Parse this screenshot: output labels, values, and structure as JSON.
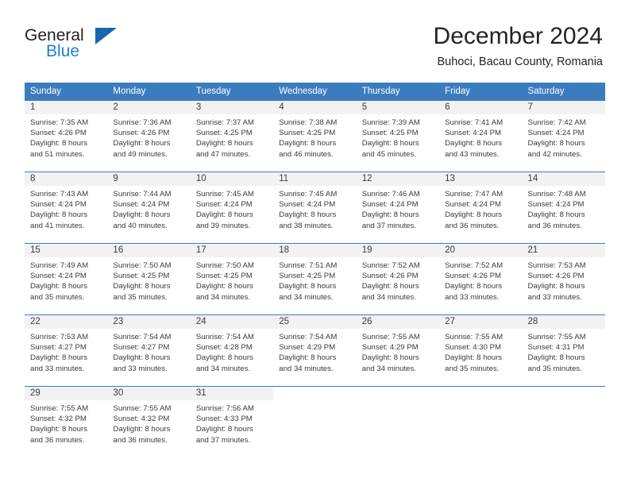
{
  "brand": {
    "name_top": "General",
    "name_bottom": "Blue",
    "accent_color": "#1f7fd0",
    "triangle_color": "#1566ab"
  },
  "header": {
    "title": "December 2024",
    "subtitle": "Buhoci, Bacau County, Romania"
  },
  "calendar": {
    "header_bg": "#3b7cbf",
    "day_bar_bg": "#f2f2f2",
    "weekdays": [
      "Sunday",
      "Monday",
      "Tuesday",
      "Wednesday",
      "Thursday",
      "Friday",
      "Saturday"
    ],
    "weeks": [
      [
        {
          "day": "1",
          "sunrise": "Sunrise: 7:35 AM",
          "sunset": "Sunset: 4:26 PM",
          "daylight_line1": "Daylight: 8 hours",
          "daylight_line2": "and 51 minutes."
        },
        {
          "day": "2",
          "sunrise": "Sunrise: 7:36 AM",
          "sunset": "Sunset: 4:26 PM",
          "daylight_line1": "Daylight: 8 hours",
          "daylight_line2": "and 49 minutes."
        },
        {
          "day": "3",
          "sunrise": "Sunrise: 7:37 AM",
          "sunset": "Sunset: 4:25 PM",
          "daylight_line1": "Daylight: 8 hours",
          "daylight_line2": "and 47 minutes."
        },
        {
          "day": "4",
          "sunrise": "Sunrise: 7:38 AM",
          "sunset": "Sunset: 4:25 PM",
          "daylight_line1": "Daylight: 8 hours",
          "daylight_line2": "and 46 minutes."
        },
        {
          "day": "5",
          "sunrise": "Sunrise: 7:39 AM",
          "sunset": "Sunset: 4:25 PM",
          "daylight_line1": "Daylight: 8 hours",
          "daylight_line2": "and 45 minutes."
        },
        {
          "day": "6",
          "sunrise": "Sunrise: 7:41 AM",
          "sunset": "Sunset: 4:24 PM",
          "daylight_line1": "Daylight: 8 hours",
          "daylight_line2": "and 43 minutes."
        },
        {
          "day": "7",
          "sunrise": "Sunrise: 7:42 AM",
          "sunset": "Sunset: 4:24 PM",
          "daylight_line1": "Daylight: 8 hours",
          "daylight_line2": "and 42 minutes."
        }
      ],
      [
        {
          "day": "8",
          "sunrise": "Sunrise: 7:43 AM",
          "sunset": "Sunset: 4:24 PM",
          "daylight_line1": "Daylight: 8 hours",
          "daylight_line2": "and 41 minutes."
        },
        {
          "day": "9",
          "sunrise": "Sunrise: 7:44 AM",
          "sunset": "Sunset: 4:24 PM",
          "daylight_line1": "Daylight: 8 hours",
          "daylight_line2": "and 40 minutes."
        },
        {
          "day": "10",
          "sunrise": "Sunrise: 7:45 AM",
          "sunset": "Sunset: 4:24 PM",
          "daylight_line1": "Daylight: 8 hours",
          "daylight_line2": "and 39 minutes."
        },
        {
          "day": "11",
          "sunrise": "Sunrise: 7:45 AM",
          "sunset": "Sunset: 4:24 PM",
          "daylight_line1": "Daylight: 8 hours",
          "daylight_line2": "and 38 minutes."
        },
        {
          "day": "12",
          "sunrise": "Sunrise: 7:46 AM",
          "sunset": "Sunset: 4:24 PM",
          "daylight_line1": "Daylight: 8 hours",
          "daylight_line2": "and 37 minutes."
        },
        {
          "day": "13",
          "sunrise": "Sunrise: 7:47 AM",
          "sunset": "Sunset: 4:24 PM",
          "daylight_line1": "Daylight: 8 hours",
          "daylight_line2": "and 36 minutes."
        },
        {
          "day": "14",
          "sunrise": "Sunrise: 7:48 AM",
          "sunset": "Sunset: 4:24 PM",
          "daylight_line1": "Daylight: 8 hours",
          "daylight_line2": "and 36 minutes."
        }
      ],
      [
        {
          "day": "15",
          "sunrise": "Sunrise: 7:49 AM",
          "sunset": "Sunset: 4:24 PM",
          "daylight_line1": "Daylight: 8 hours",
          "daylight_line2": "and 35 minutes."
        },
        {
          "day": "16",
          "sunrise": "Sunrise: 7:50 AM",
          "sunset": "Sunset: 4:25 PM",
          "daylight_line1": "Daylight: 8 hours",
          "daylight_line2": "and 35 minutes."
        },
        {
          "day": "17",
          "sunrise": "Sunrise: 7:50 AM",
          "sunset": "Sunset: 4:25 PM",
          "daylight_line1": "Daylight: 8 hours",
          "daylight_line2": "and 34 minutes."
        },
        {
          "day": "18",
          "sunrise": "Sunrise: 7:51 AM",
          "sunset": "Sunset: 4:25 PM",
          "daylight_line1": "Daylight: 8 hours",
          "daylight_line2": "and 34 minutes."
        },
        {
          "day": "19",
          "sunrise": "Sunrise: 7:52 AM",
          "sunset": "Sunset: 4:26 PM",
          "daylight_line1": "Daylight: 8 hours",
          "daylight_line2": "and 34 minutes."
        },
        {
          "day": "20",
          "sunrise": "Sunrise: 7:52 AM",
          "sunset": "Sunset: 4:26 PM",
          "daylight_line1": "Daylight: 8 hours",
          "daylight_line2": "and 33 minutes."
        },
        {
          "day": "21",
          "sunrise": "Sunrise: 7:53 AM",
          "sunset": "Sunset: 4:26 PM",
          "daylight_line1": "Daylight: 8 hours",
          "daylight_line2": "and 33 minutes."
        }
      ],
      [
        {
          "day": "22",
          "sunrise": "Sunrise: 7:53 AM",
          "sunset": "Sunset: 4:27 PM",
          "daylight_line1": "Daylight: 8 hours",
          "daylight_line2": "and 33 minutes."
        },
        {
          "day": "23",
          "sunrise": "Sunrise: 7:54 AM",
          "sunset": "Sunset: 4:27 PM",
          "daylight_line1": "Daylight: 8 hours",
          "daylight_line2": "and 33 minutes."
        },
        {
          "day": "24",
          "sunrise": "Sunrise: 7:54 AM",
          "sunset": "Sunset: 4:28 PM",
          "daylight_line1": "Daylight: 8 hours",
          "daylight_line2": "and 34 minutes."
        },
        {
          "day": "25",
          "sunrise": "Sunrise: 7:54 AM",
          "sunset": "Sunset: 4:29 PM",
          "daylight_line1": "Daylight: 8 hours",
          "daylight_line2": "and 34 minutes."
        },
        {
          "day": "26",
          "sunrise": "Sunrise: 7:55 AM",
          "sunset": "Sunset: 4:29 PM",
          "daylight_line1": "Daylight: 8 hours",
          "daylight_line2": "and 34 minutes."
        },
        {
          "day": "27",
          "sunrise": "Sunrise: 7:55 AM",
          "sunset": "Sunset: 4:30 PM",
          "daylight_line1": "Daylight: 8 hours",
          "daylight_line2": "and 35 minutes."
        },
        {
          "day": "28",
          "sunrise": "Sunrise: 7:55 AM",
          "sunset": "Sunset: 4:31 PM",
          "daylight_line1": "Daylight: 8 hours",
          "daylight_line2": "and 35 minutes."
        }
      ],
      [
        {
          "day": "29",
          "sunrise": "Sunrise: 7:55 AM",
          "sunset": "Sunset: 4:32 PM",
          "daylight_line1": "Daylight: 8 hours",
          "daylight_line2": "and 36 minutes."
        },
        {
          "day": "30",
          "sunrise": "Sunrise: 7:55 AM",
          "sunset": "Sunset: 4:32 PM",
          "daylight_line1": "Daylight: 8 hours",
          "daylight_line2": "and 36 minutes."
        },
        {
          "day": "31",
          "sunrise": "Sunrise: 7:56 AM",
          "sunset": "Sunset: 4:33 PM",
          "daylight_line1": "Daylight: 8 hours",
          "daylight_line2": "and 37 minutes."
        },
        {
          "day": "",
          "sunrise": "",
          "sunset": "",
          "daylight_line1": "",
          "daylight_line2": ""
        },
        {
          "day": "",
          "sunrise": "",
          "sunset": "",
          "daylight_line1": "",
          "daylight_line2": ""
        },
        {
          "day": "",
          "sunrise": "",
          "sunset": "",
          "daylight_line1": "",
          "daylight_line2": ""
        },
        {
          "day": "",
          "sunrise": "",
          "sunset": "",
          "daylight_line1": "",
          "daylight_line2": ""
        }
      ]
    ]
  }
}
